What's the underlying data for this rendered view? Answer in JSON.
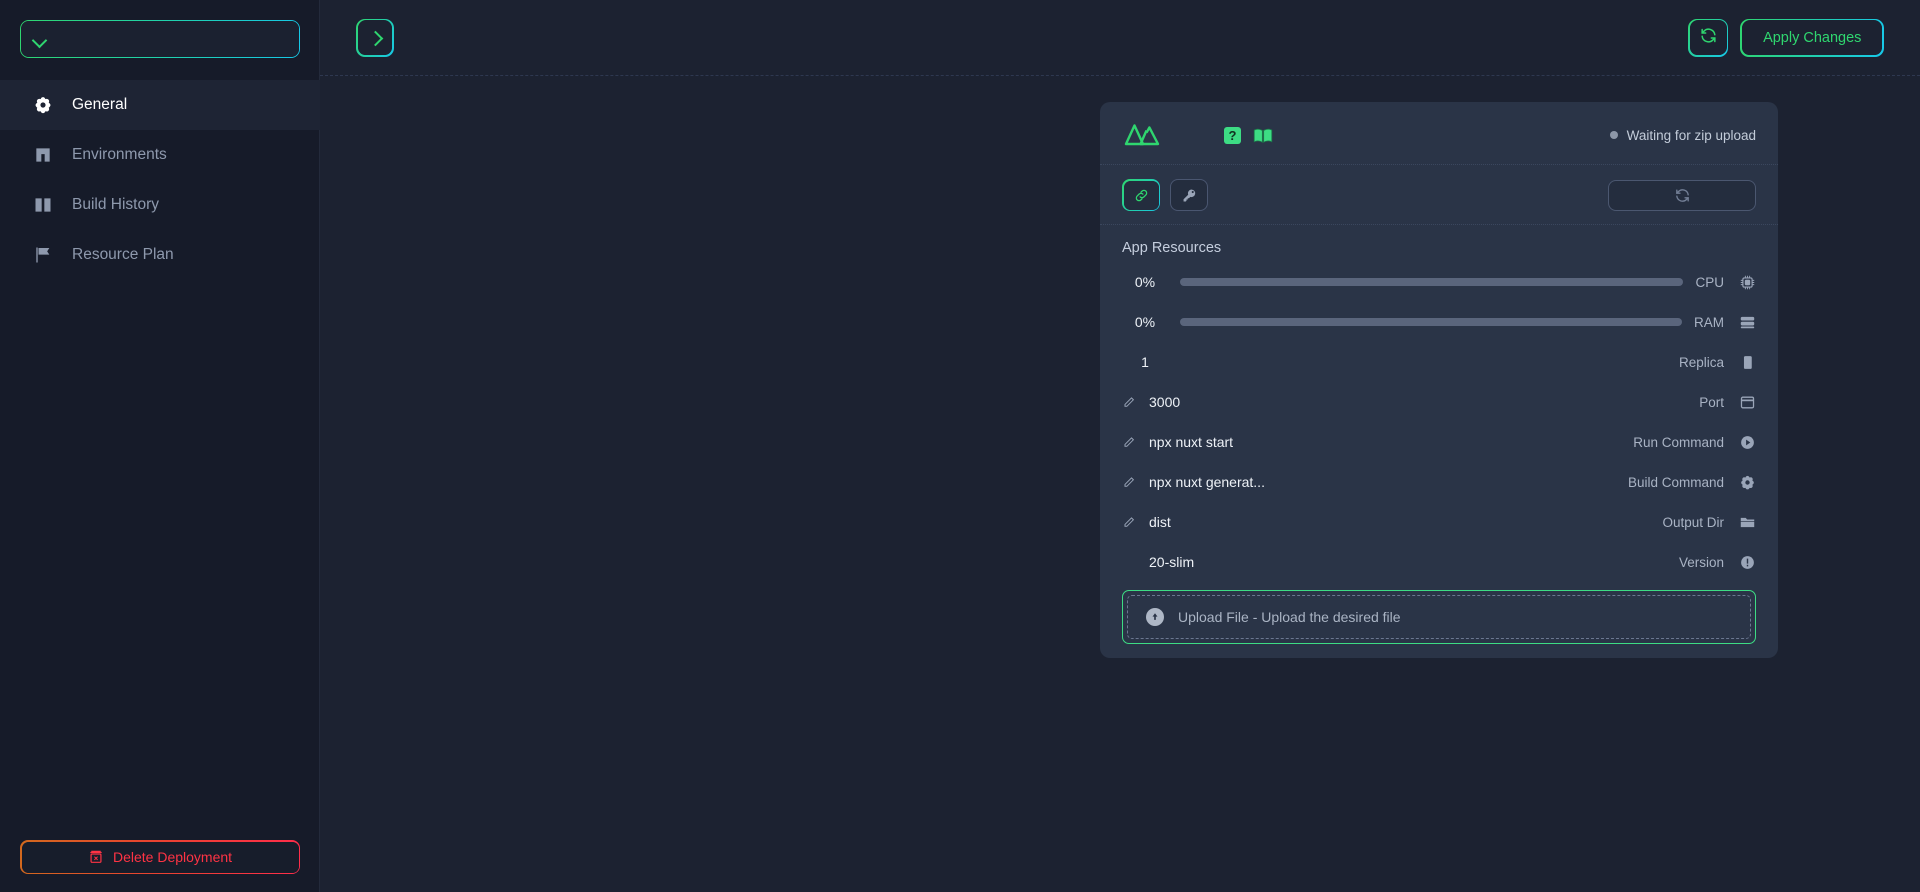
{
  "sidebar": {
    "deployment_select": {
      "value": "",
      "placeholder": "",
      "icon": "chevron-down-icon"
    },
    "items": [
      {
        "label": "General",
        "icon": "gear-icon",
        "active": true
      },
      {
        "label": "Environments",
        "icon": "cube-icon",
        "active": false
      },
      {
        "label": "Build History",
        "icon": "book-icon",
        "active": false
      },
      {
        "label": "Resource Plan",
        "icon": "flag-icon",
        "active": false
      }
    ],
    "delete_button": {
      "label": "Delete Deployment",
      "icon": "trash-x-icon",
      "color": "#ff3344"
    }
  },
  "topbar": {
    "collapse_button": {
      "icon": "chevron-right-icon"
    },
    "refresh_button": {
      "icon": "refresh-icon"
    },
    "apply_button": {
      "label": "Apply Changes",
      "color": "#2fd66f"
    }
  },
  "card": {
    "framework_logo": "nuxt-logo",
    "help_badge": "?",
    "docs_icon": "open-book-icon",
    "status": {
      "text": "Waiting for zip upload",
      "dot_color": "#8d97a8"
    },
    "tools": [
      {
        "name": "link-icon",
        "active": true
      },
      {
        "name": "key-icon",
        "active": false
      }
    ],
    "refresh_wide": {
      "icon": "refresh-icon"
    },
    "section_title": "App Resources",
    "resources": [
      {
        "value": "0%",
        "label": "CPU",
        "icon": "cpu-icon",
        "type": "bar",
        "percent": 0,
        "editable": false
      },
      {
        "value": "0%",
        "label": "RAM",
        "icon": "ram-icon",
        "type": "bar",
        "percent": 0,
        "editable": false
      },
      {
        "value": "1",
        "label": "Replica",
        "icon": "clone-icon",
        "type": "text",
        "editable": false
      },
      {
        "value": "3000",
        "label": "Port",
        "icon": "window-icon",
        "type": "text",
        "editable": true
      },
      {
        "value": "npx nuxt start",
        "label": "Run Command",
        "icon": "play-icon",
        "type": "text",
        "editable": true
      },
      {
        "value": "npx nuxt generat...",
        "label": "Build Command",
        "icon": "gear-icon",
        "type": "text",
        "editable": true
      },
      {
        "value": "dist",
        "label": "Output Dir",
        "icon": "folder-icon",
        "type": "text",
        "editable": true
      },
      {
        "value": "20-slim",
        "label": "Version",
        "icon": "info-icon",
        "type": "text",
        "editable": false
      }
    ],
    "upload": {
      "text": "Upload File - Upload the desired file",
      "icon": "upload-circle-icon",
      "border_color": "#3ddc84"
    }
  }
}
